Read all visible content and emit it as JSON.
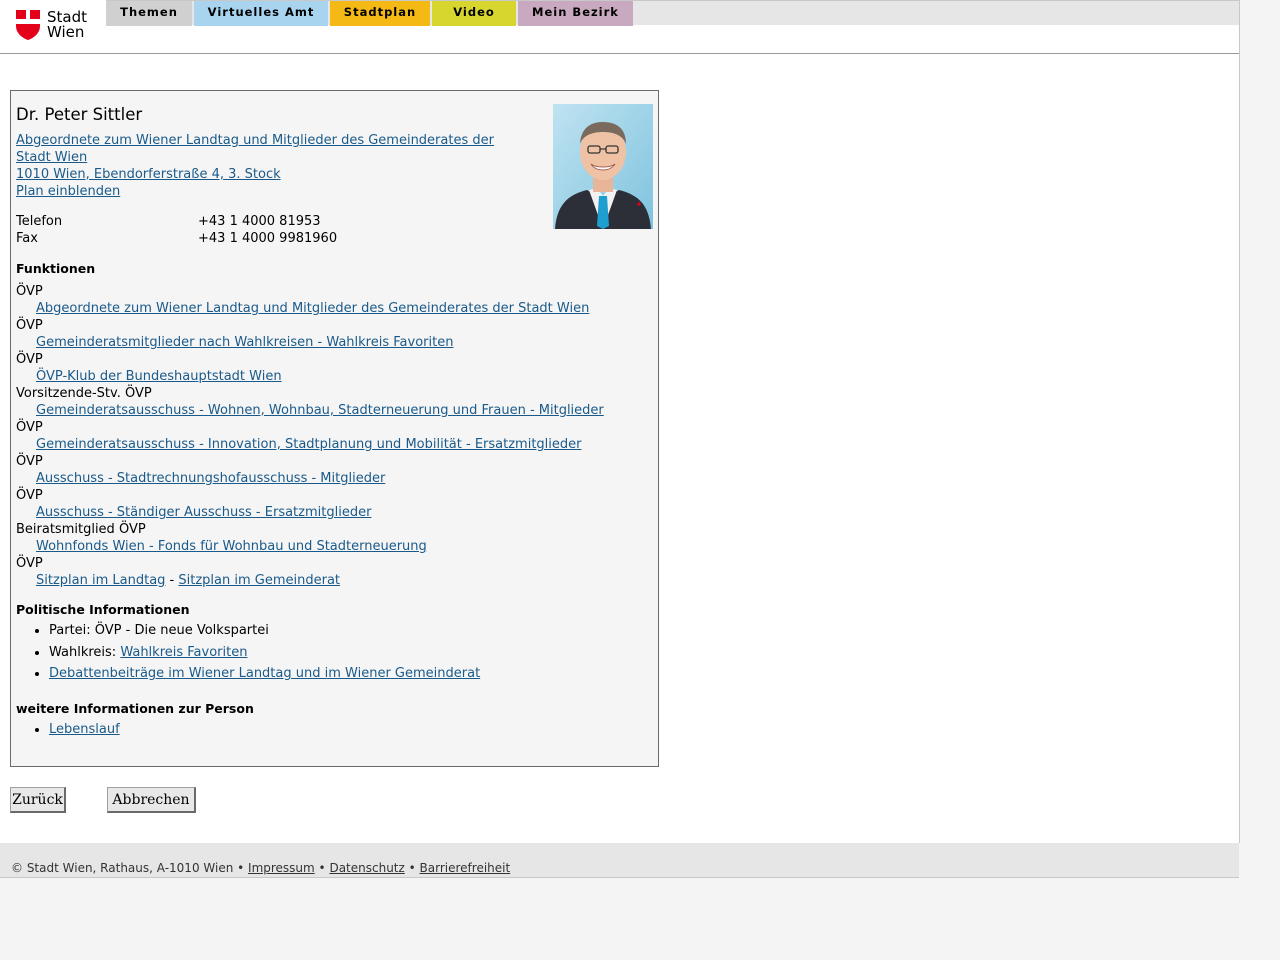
{
  "logo": {
    "line1": "Stadt",
    "line2": "Wien",
    "colors": {
      "red": "#e4001b"
    }
  },
  "nav": [
    {
      "label": "Themen",
      "color": "#d0d0d0"
    },
    {
      "label": "Virtuelles Amt",
      "color": "#a9d4ef"
    },
    {
      "label": "Stadtplan",
      "color": "#f5b915"
    },
    {
      "label": "Video",
      "color": "#d6d62f"
    },
    {
      "label": "Mein Bezirk",
      "color": "#c9a9c0"
    }
  ],
  "person": {
    "name": "Dr. Peter Sittler",
    "org_line": "Abgeordnete zum Wiener Landtag und Mitglieder des Gemeinderates der Stadt Wien",
    "address": "1010 Wien, Ebendorferstraße 4, 3. Stock",
    "plan_link": "Plan einblenden",
    "phone_label": "Telefon",
    "phone": "+43 1 4000 81953",
    "fax_label": "Fax",
    "fax": "+43 1 4000 9981960"
  },
  "functions_heading": "Funktionen",
  "functions": [
    {
      "role": "ÖVP",
      "link": "Abgeordnete zum Wiener Landtag und Mitglieder des Gemeinderates der Stadt Wien"
    },
    {
      "role": "ÖVP",
      "link": "Gemeinderatsmitglieder nach Wahlkreisen - Wahlkreis Favoriten"
    },
    {
      "role": "ÖVP",
      "link": "ÖVP-Klub der Bundeshauptstadt Wien"
    },
    {
      "role": "Vorsitzende-Stv. ÖVP",
      "link": "Gemeinderatsausschuss - Wohnen, Wohnbau, Stadterneuerung und Frauen - Mitglieder"
    },
    {
      "role": "ÖVP",
      "link": "Gemeinderatsausschuss - Innovation, Stadtplanung und Mobilität - Ersatzmitglieder"
    },
    {
      "role": "ÖVP",
      "link": "Ausschuss - Stadtrechnungshofausschuss - Mitglieder"
    },
    {
      "role": "ÖVP",
      "link": "Ausschuss - Ständiger Ausschuss - Ersatzmitglieder"
    },
    {
      "role": "Beiratsmitglied ÖVP",
      "link": "Wohnfonds Wien - Fonds für Wohnbau und Stadterneuerung"
    }
  ],
  "seating": {
    "role": "ÖVP",
    "link1": "Sitzplan im Landtag",
    "separator": " - ",
    "link2": "Sitzplan im Gemeinderat"
  },
  "political_heading": "Politische Informationen",
  "political": {
    "party": "Partei: ÖVP - Die neue Volkspartei",
    "district_label": "Wahlkreis: ",
    "district_link": "Wahlkreis Favoriten",
    "debates_link": "Debattenbeiträge im Wiener Landtag und im Wiener Gemeinderat"
  },
  "further_heading": "weitere Informationen zur Person",
  "further": {
    "cv_link": "Lebenslauf"
  },
  "buttons": {
    "back": "Zurück",
    "cancel": "Abbrechen"
  },
  "footer": {
    "copyright": "© Stadt Wien, Rathaus, A-1010 Wien",
    "sep": " • ",
    "impressum": "Impressum",
    "datenschutz": "Datenschutz",
    "barrierefreiheit": "Barrierefreiheit"
  }
}
